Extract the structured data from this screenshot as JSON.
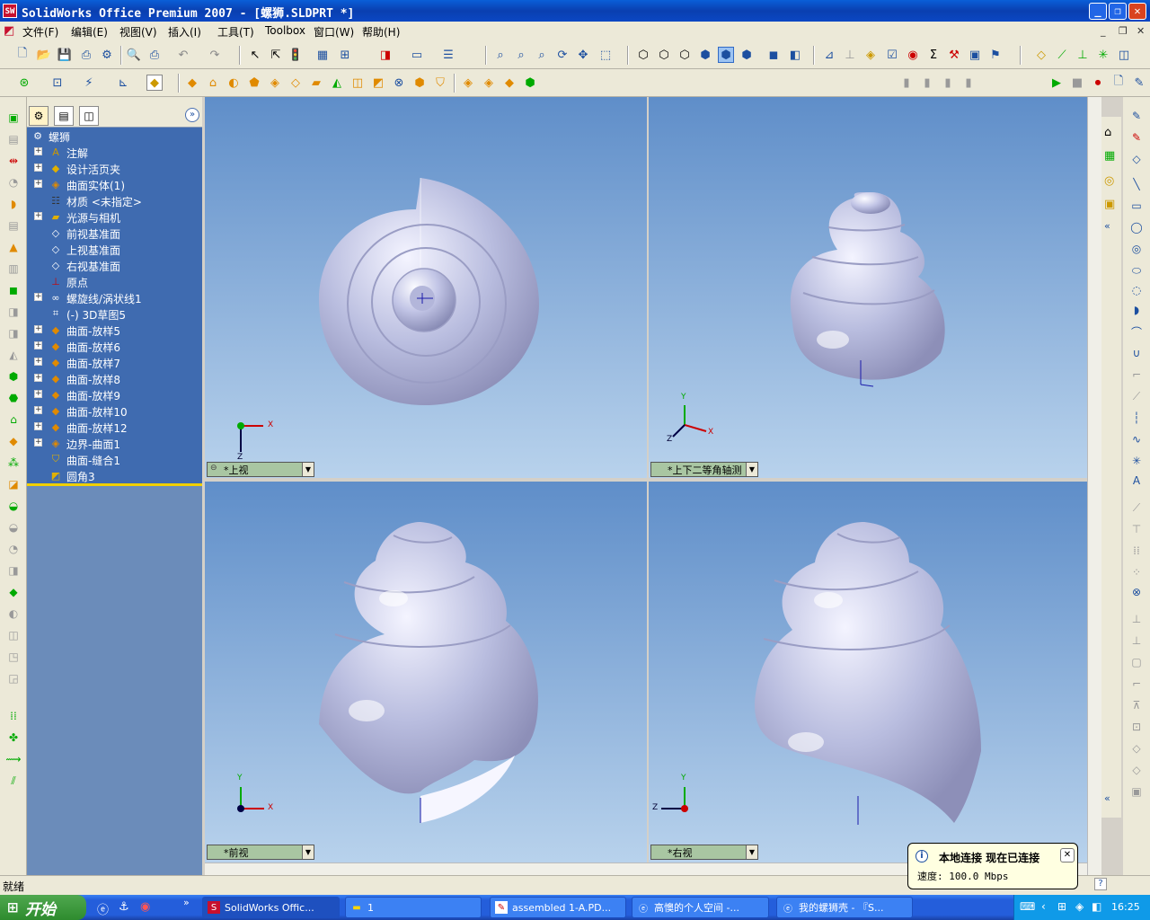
{
  "window": {
    "title": "SolidWorks Office Premium 2007 - [螺狮.SLDPRT *]",
    "app_icon": "SW",
    "buttons": [
      "minimize",
      "maximize",
      "close"
    ]
  },
  "menu": {
    "items": [
      "文件(F)",
      "编辑(E)",
      "视图(V)",
      "插入(I)",
      "工具(T)",
      "Toolbox",
      "窗口(W)",
      "帮助(H)"
    ]
  },
  "feature_manager": {
    "root": "螺狮",
    "items": [
      {
        "label": "注解",
        "expandable": true,
        "icon": "annotation-icon"
      },
      {
        "label": "设计活页夹",
        "expandable": true,
        "icon": "binder-icon"
      },
      {
        "label": "曲面实体(1)",
        "expandable": true,
        "icon": "surface-body-icon"
      },
      {
        "label": "材质 <未指定>",
        "expandable": false,
        "icon": "material-icon"
      },
      {
        "label": "光源与相机",
        "expandable": true,
        "icon": "lights-icon"
      },
      {
        "label": "前视基准面",
        "expandable": false,
        "icon": "plane-icon"
      },
      {
        "label": "上视基准面",
        "expandable": false,
        "icon": "plane-icon"
      },
      {
        "label": "右视基准面",
        "expandable": false,
        "icon": "plane-icon"
      },
      {
        "label": "原点",
        "expandable": false,
        "icon": "origin-icon"
      },
      {
        "label": "螺旋线/涡状线1",
        "expandable": true,
        "icon": "helix-icon"
      },
      {
        "label": "(-) 3D草图5",
        "expandable": false,
        "icon": "sketch3d-icon"
      },
      {
        "label": "曲面-放样5",
        "expandable": true,
        "icon": "loft-icon"
      },
      {
        "label": "曲面-放样6",
        "expandable": true,
        "icon": "loft-icon"
      },
      {
        "label": "曲面-放样7",
        "expandable": true,
        "icon": "loft-icon"
      },
      {
        "label": "曲面-放样8",
        "expandable": true,
        "icon": "loft-icon"
      },
      {
        "label": "曲面-放样9",
        "expandable": true,
        "icon": "loft-icon"
      },
      {
        "label": "曲面-放样10",
        "expandable": true,
        "icon": "loft-icon"
      },
      {
        "label": "曲面-放样12",
        "expandable": true,
        "icon": "loft-icon"
      },
      {
        "label": "边界-曲面1",
        "expandable": true,
        "icon": "boundary-icon"
      },
      {
        "label": "曲面-缝合1",
        "expandable": false,
        "icon": "knit-icon"
      },
      {
        "label": "圆角3",
        "expandable": false,
        "icon": "fillet-icon"
      }
    ]
  },
  "viewports": [
    {
      "label": "*上视",
      "axes": [
        "X",
        "Z"
      ]
    },
    {
      "label": "*上下二等角轴测",
      "axes": [
        "Y",
        "X",
        "Z"
      ]
    },
    {
      "label": "*前视",
      "axes": [
        "Y",
        "X"
      ]
    },
    {
      "label": "*右视",
      "axes": [
        "Y",
        "Z"
      ]
    }
  ],
  "status": {
    "text": "就绪",
    "help": "?"
  },
  "balloon": {
    "title": "本地连接 现在已连接",
    "body": "速度: 100.0 Mbps"
  },
  "taskbar": {
    "start": "开始",
    "tasks": [
      "SolidWorks Offic...",
      "1",
      "assembled 1-A.PD...",
      "高懊的个人空间 -...",
      "我的螺狮壳 - 『S..."
    ],
    "clock": "16:25"
  },
  "colors": {
    "accent": "#0a5fd8",
    "viewport_top": "#5f8ec9",
    "viewport_bottom": "#b8d2ec",
    "tree_bg": "#3f6bb0",
    "shell": "#c9cbe6"
  }
}
